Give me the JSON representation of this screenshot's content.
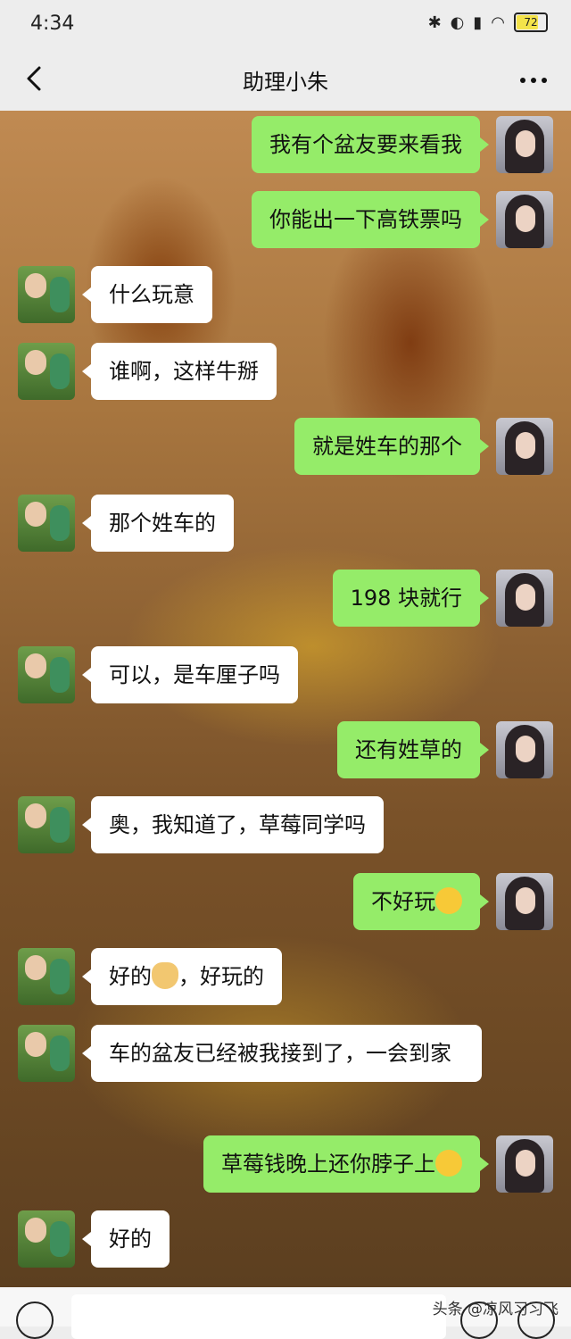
{
  "status_bar": {
    "time": "4:34",
    "battery": "72"
  },
  "header": {
    "title": "助理小朱"
  },
  "messages": [
    {
      "side": "me",
      "text": "我有个盆友要来看我"
    },
    {
      "side": "me",
      "text": "你能出一下高铁票吗"
    },
    {
      "side": "other",
      "text": "什么玩意"
    },
    {
      "side": "other",
      "text": "谁啊，这样牛掰"
    },
    {
      "side": "me",
      "text": "就是姓车的那个"
    },
    {
      "side": "other",
      "text": "那个姓车的"
    },
    {
      "side": "me",
      "text": "198 块就行"
    },
    {
      "side": "other",
      "text": "可以，是车厘子吗"
    },
    {
      "side": "me",
      "text": "还有姓草的"
    },
    {
      "side": "other",
      "text": "奥，我知道了，草莓同学吗"
    },
    {
      "side": "me",
      "text": "不好玩",
      "emoji": "flushed-face-emoji"
    },
    {
      "side": "other",
      "text_before": "好的",
      "emoji": "ok-hand-emoji",
      "text_after": "，好玩的"
    },
    {
      "side": "other",
      "text": "车的盆友已经被我接到了，一会到家"
    },
    {
      "side": "me",
      "text": "草莓钱晚上还你脖子上",
      "emoji": "smiling-face-emoji"
    },
    {
      "side": "other",
      "text": "好的"
    }
  ],
  "watermark": "头条 @凉风习习飞"
}
